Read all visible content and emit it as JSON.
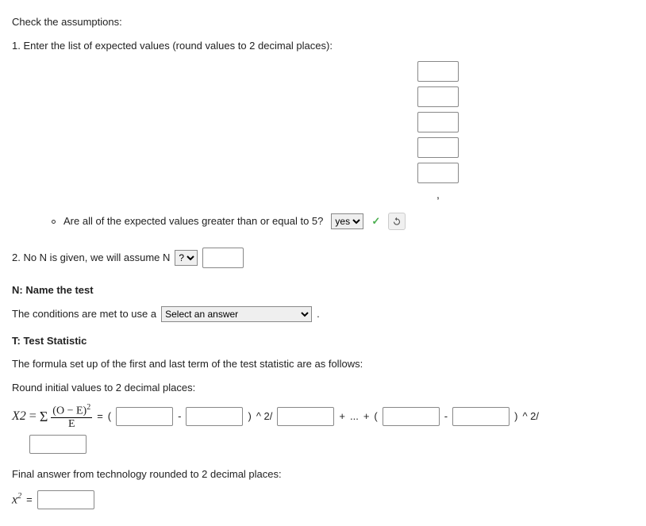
{
  "heading_check": "Check the assumptions:",
  "step1": "1. Enter the list of expected values (round values to 2 decimal places):",
  "comma": ",",
  "bullet_q": "Are all of the expected values greater than or equal to 5?",
  "yes_option": "yes",
  "step2_prefix": "2. No N is given, we will assume N",
  "q_option": "?",
  "n_heading": "N: Name the test",
  "n_line_prefix": "The conditions are met to use a",
  "select_answer": "Select an answer",
  "period": ".",
  "t_heading": "T: Test Statistic",
  "t_line1": "The formula set up of the first and last term of the test statistic are as follows:",
  "t_line2": "Round initial values to 2 decimal places:",
  "chi_label": "Χ2",
  "equals": "=",
  "lparen": "(",
  "rparen": ")",
  "minus": "-",
  "plus": "+",
  "dots": "...",
  "pow2_over": "^ 2/",
  "formula_num": "(O − E)",
  "formula_num_sup": "2",
  "formula_den": "E",
  "final_line": "Final answer from technology rounded to 2 decimal places:",
  "x2_label": "x",
  "x2_sup": "2"
}
